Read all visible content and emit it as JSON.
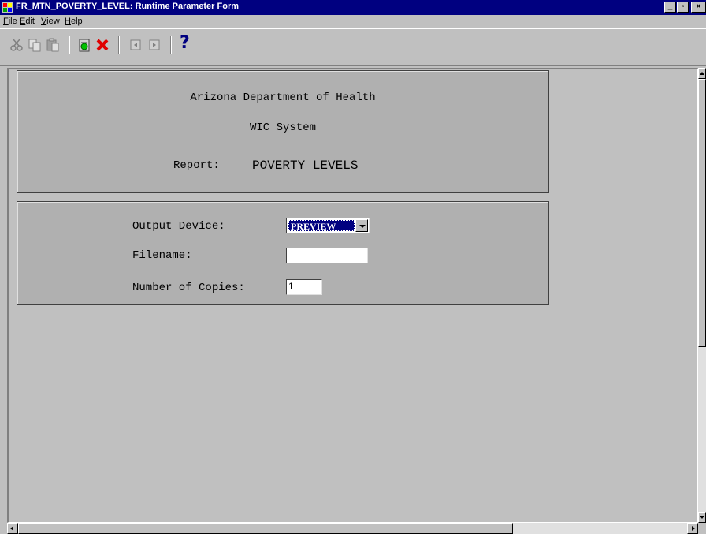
{
  "window": {
    "title": "FR_MTN_POVERTY_LEVEL: Runtime Parameter Form",
    "minimize_label": "_",
    "maximize_label": "▫",
    "close_label": "×"
  },
  "menu": {
    "items": [
      {
        "label_underlined": "F",
        "label_rest": "ile"
      },
      {
        "label_underlined": "E",
        "label_rest": "dit"
      },
      {
        "label_underlined": "V",
        "label_rest": "iew"
      },
      {
        "label_underlined": "H",
        "label_rest": "elp"
      }
    ]
  },
  "toolbar": {
    "icons": [
      "cut-icon",
      "copy-icon",
      "paste-icon",
      "run-report-icon",
      "cancel-icon",
      "previous-page-icon",
      "next-page-icon",
      "help-icon"
    ],
    "help_glyph": "?"
  },
  "header": {
    "line1": "Arizona Department of Health",
    "line2": "WIC System",
    "report_label": "Report:",
    "report_name": "POVERTY LEVELS"
  },
  "params": {
    "output_device_label": "Output Device:",
    "output_device_value": "PREVIEW",
    "filename_label": "Filename:",
    "filename_value": "",
    "copies_label": "Number of Copies:",
    "copies_value": "1"
  },
  "colors": {
    "titlebar": "#000080",
    "face": "#c0c0c0",
    "panel": "#b0b0b0",
    "cancel_red": "#e00000"
  }
}
